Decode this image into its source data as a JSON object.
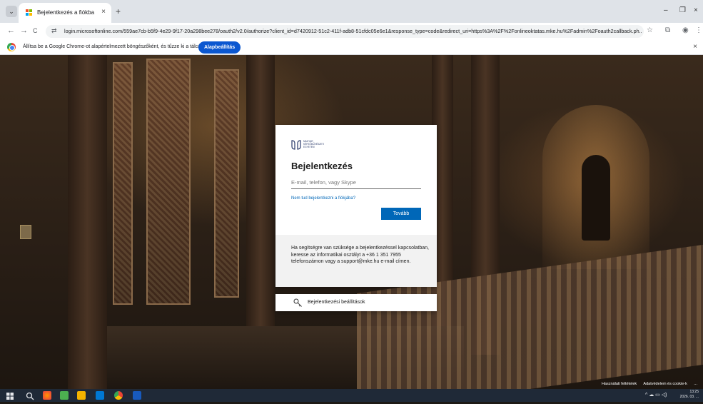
{
  "browser": {
    "tab_menu_label": "⌄",
    "tab_title": "Bejelentkezés a fiókba",
    "tab_close": "×",
    "new_tab": "+",
    "minimize": "–",
    "restore": "❐",
    "close": "×",
    "back": "←",
    "forward": "→",
    "reload": "C",
    "url": "login.microsoftonline.com/559ae7cb-b5f9-4e29-9f17-20a298bee278/oauth2/v2.0/authorize?client_id=d7420912-51c2-411f-adb8-51cfdc05e6e1&response_type=code&redirect_uri=https%3A%2F%2Fonlineoktatas.mke.hu%2Fadmin%2Foauth2callback.ph...",
    "bookmark_icon": "☆",
    "extension_icon": "⧉",
    "profile_icon": "◉",
    "menu_icon": "⋮"
  },
  "infobar": {
    "text": "Állítsa be a Google Chrome-ot alapértelmezett böngészőként, és tűzze ki a tálcára",
    "button": "Alapbeállítás",
    "close": "×"
  },
  "signin": {
    "logo_text": "MAGYAR KÉPZŐMŰVÉSZETI EGYETEM",
    "title": "Bejelentkezés",
    "email_placeholder": "E-mail, telefon, vagy Skype",
    "email_value": "",
    "help_link": "Nem tud bejelentkezni a fiókjába?",
    "next_button": "Tovább",
    "support_text": "Ha segítségre van szüksége a bejelentkezéssel kapcsolatban, keresse az informatikai osztályt a +36 1 351 7955 telefonszámon vagy a support@mke.hu e-mail címen.",
    "options_label": "Bejelentkezési beállítások"
  },
  "footer": {
    "terms": "Használati feltételek",
    "privacy": "Adatvédelem és cookie-k",
    "more": "..."
  },
  "taskbar": {
    "tray": "^ ☁ ▭ ◁)",
    "time": "13:25",
    "date": "2026. 03. ..."
  },
  "colors": {
    "accent": "#0067b8",
    "chrome_button": "#0b57d0"
  }
}
